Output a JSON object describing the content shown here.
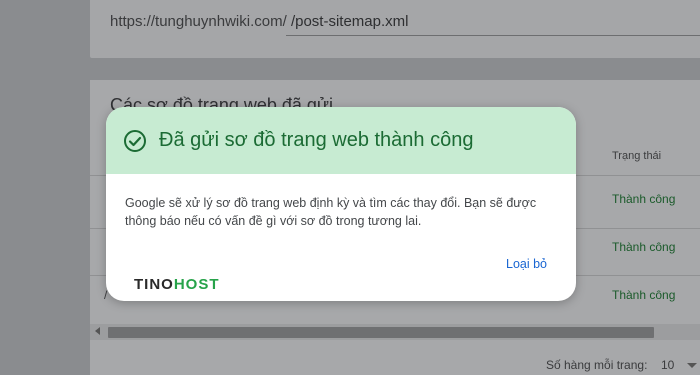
{
  "sitemap_url": {
    "prefix": "https://tunghuynhwiki.com/",
    "value": "/post-sitemap.xml"
  },
  "submitted_list": {
    "title": "Các sơ đồ trang web đã gửi",
    "status_header": "Trạng thái",
    "rows": [
      {
        "stub": "",
        "status": "Thành công"
      },
      {
        "stub": "",
        "status": "Thành công"
      },
      {
        "stub": "/",
        "status": "Thành công"
      }
    ],
    "footer": {
      "rows_per_page_label": "Số hàng mỗi trang:",
      "rows_per_page_value": "10"
    }
  },
  "dialog": {
    "title": "Đã gửi sơ đồ trang web thành công",
    "message": "Google sẽ xử lý sơ đồ trang web định kỳ và tìm các thay đổi. Bạn sẽ được thông báo nếu có vấn đề gì với sơ đồ trong tương lai.",
    "dismiss_label": "Loại bỏ",
    "icon": "check-circle-icon"
  },
  "watermark": {
    "part1": "TINO",
    "part2": "HOST"
  },
  "colors": {
    "success_header_bg": "#c7ebd2",
    "success_text": "#1b6b34",
    "link": "#1a66d2"
  }
}
